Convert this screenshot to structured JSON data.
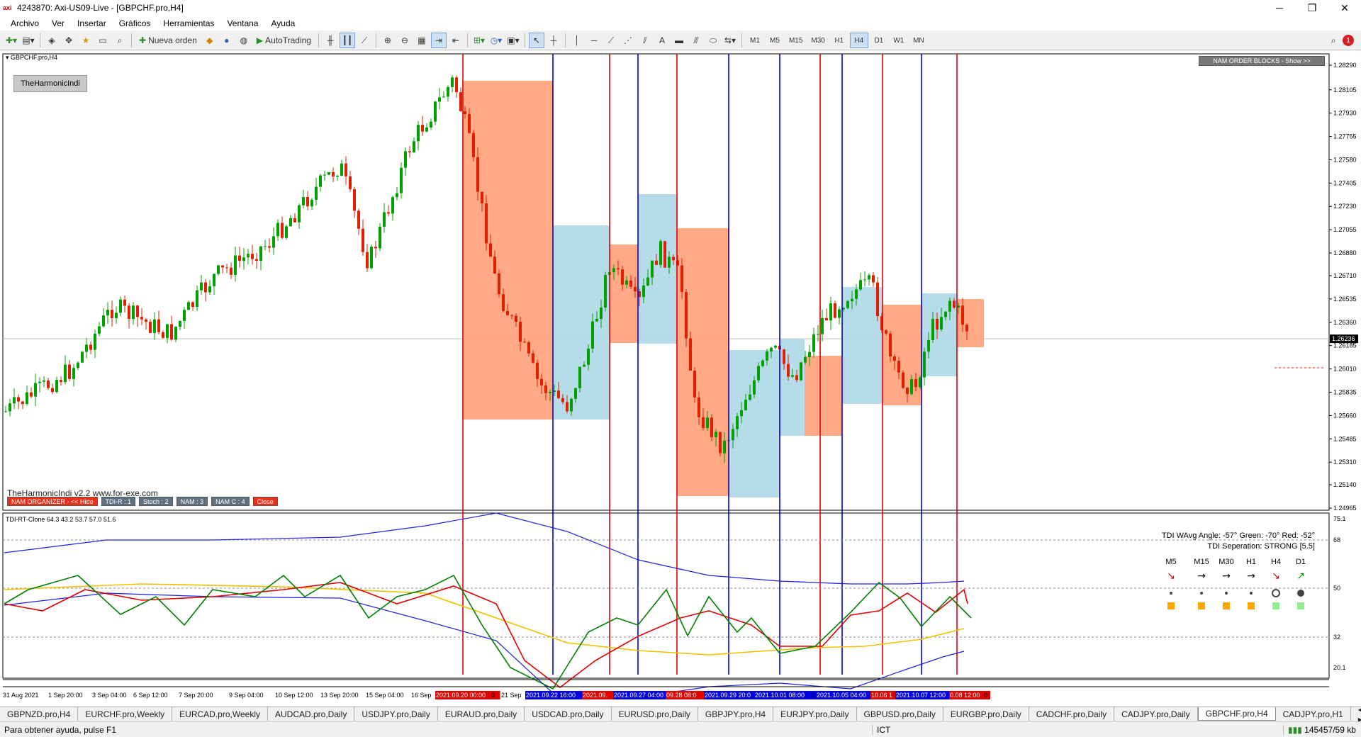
{
  "window": {
    "title": "4243870: Axi-US09-Live - [GBPCHF.pro,H4]"
  },
  "menu": [
    "Archivo",
    "Ver",
    "Insertar",
    "Gráficos",
    "Herramientas",
    "Ventana",
    "Ayuda"
  ],
  "toolbar": {
    "new_order": "Nueva orden",
    "autotrading": "AutoTrading",
    "timeframes": [
      "M1",
      "M5",
      "M15",
      "M30",
      "H1",
      "H4",
      "D1",
      "W1",
      "MN"
    ],
    "active_timeframe": "H4"
  },
  "chart": {
    "symbol_label": "GBPCHF.pro,H4",
    "price_ticks": [
      "1.28290",
      "1.28105",
      "1.27930",
      "1.27755",
      "1.27580",
      "1.27405",
      "1.27230",
      "1.27055",
      "1.26880",
      "1.26710",
      "1.26535",
      "1.26360",
      "1.26185",
      "1.26010",
      "1.25835",
      "1.25660",
      "1.25485",
      "1.25310",
      "1.25140",
      "1.24965"
    ],
    "current_price": "1.26236",
    "harmonic_button": "TheHarmonicIndi",
    "nam_ob_button": "NAM ORDER BLOCKS - Show >>",
    "harmonic_version": "TheHarmonicIndi v2.2 www.for-exe.com",
    "nam_buttons": [
      "NAM ORGANIZER - << Hide",
      "TDI-R : 1",
      "Stoch : 2",
      "NAM : 3",
      "NAM C : 4",
      "Close"
    ],
    "nam_button_colors": [
      "#e8301a",
      "#607080",
      "#607080",
      "#607080",
      "#607080",
      "#e8301a"
    ],
    "bull_color": "#00a000",
    "bear_color": "#e02000",
    "demand_zone_color": "#add8e6",
    "supply_zone_color": "#ffa07a"
  },
  "tdi": {
    "label": "TDI-RT-Clone 64.3 43.2 53.7 57.0 51.6",
    "ticks": [
      "75.1",
      "68",
      "50",
      "32",
      "20.1"
    ],
    "angle_text": "TDI WAvg Angle: -57°  Green: -70°  Red: -52°",
    "separation_text": "TDI Seperation: STRONG [5.5]",
    "tf_headers": [
      "M5",
      "M15",
      "M30",
      "H1",
      "H4",
      "D1"
    ]
  },
  "time_axis": {
    "labels": [
      "31 Aug 2021",
      "1 Sep 20:00",
      "3 Sep 04:00",
      "6 Sep 12:00",
      "7 Sep 20:00",
      "9 Sep 04:00",
      "10 Sep 12:00",
      "13 Sep 20:00",
      "15 Sep 04:00",
      "16 Sep",
      "2021.09.20 00:00",
      "0",
      "21 Sep",
      "2021.09.22 16:00",
      "2021.09.",
      "2021.09.27 04:00",
      "09.28 08:0",
      "2021.09.29 20:0",
      "2021.10.01 08:00",
      "1",
      "2021.10.05 04:00",
      "10.06 1",
      "2021.10.07 12:00",
      "0.08 12:00",
      "0"
    ]
  },
  "tabs": [
    "GBPNZD.pro,H4",
    "EURCHF.pro,Weekly",
    "EURCAD.pro,Weekly",
    "AUDCAD.pro,Daily",
    "USDJPY.pro,Daily",
    "EURAUD.pro,Daily",
    "USDCAD.pro,Daily",
    "EURUSD.pro,Daily",
    "GBPJPY.pro,H4",
    "EURJPY.pro,Daily",
    "GBPUSD.pro,Daily",
    "EURGBP.pro,Daily",
    "CADCHF.pro,Daily",
    "CADJPY.pro,Daily",
    "GBPCHF.pro,H4",
    "CADJPY.pro,H1"
  ],
  "active_tab": "GBPCHF.pro,H4",
  "status": {
    "help": "Para obtener ayuda, pulse F1",
    "profile": "ICT",
    "traffic": "145457/59 kb"
  }
}
